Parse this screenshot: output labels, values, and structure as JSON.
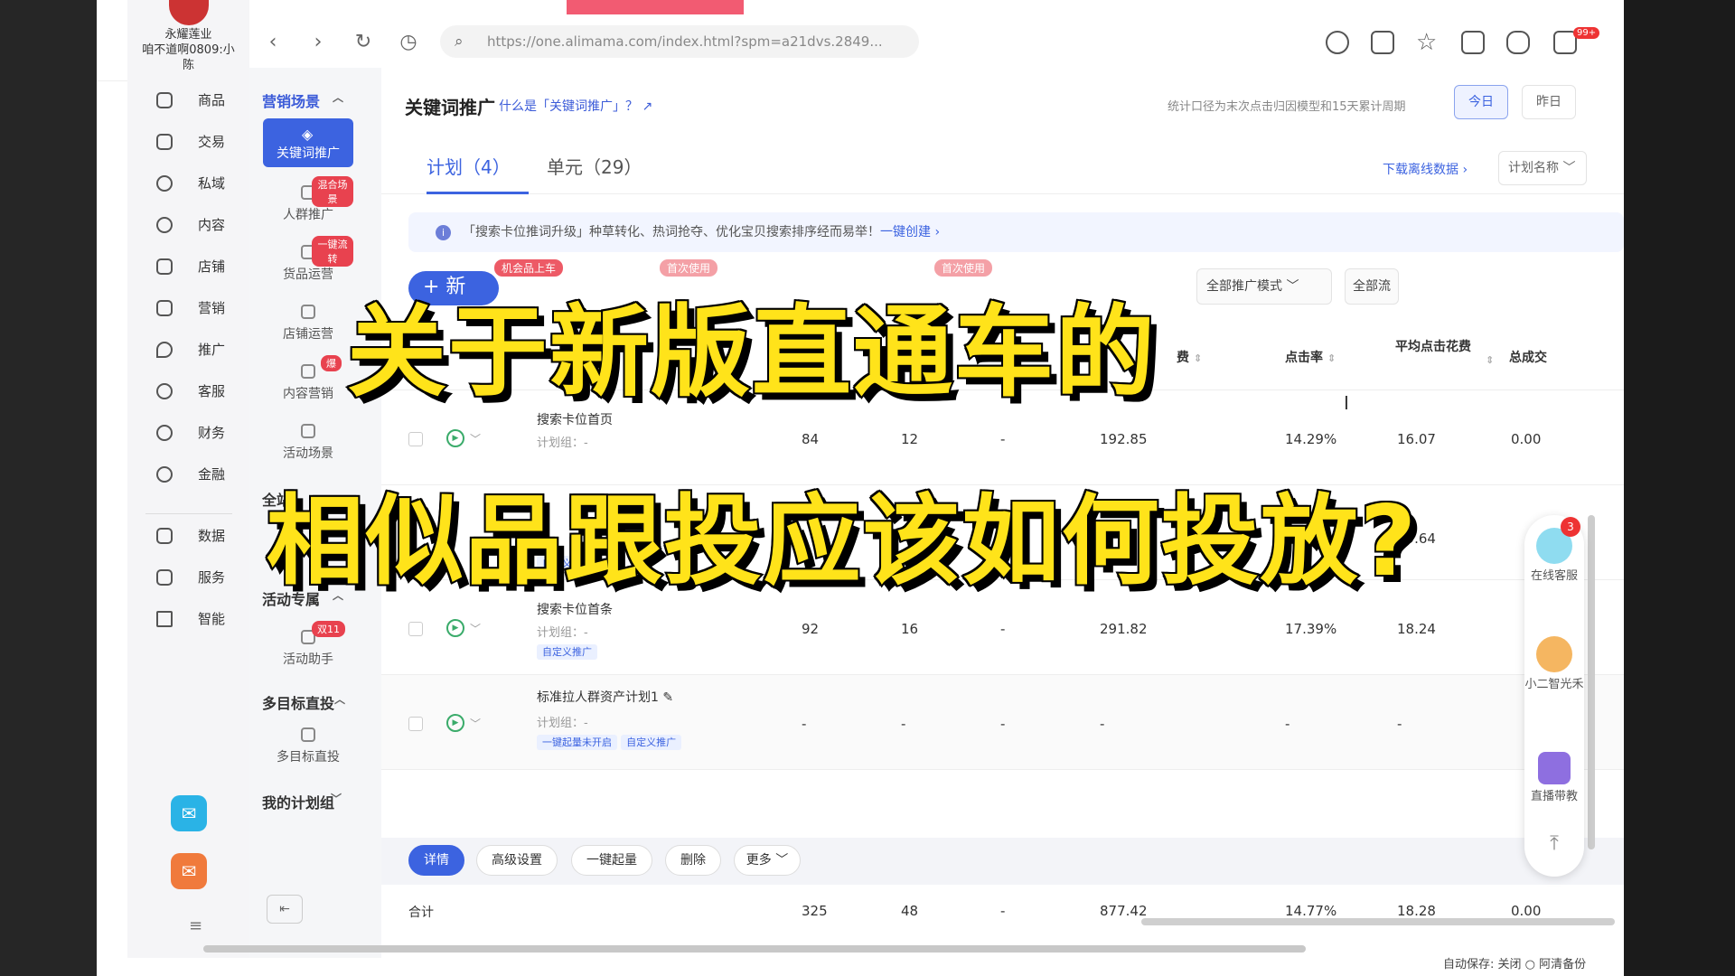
{
  "browser": {
    "url": "https://one.alimama.com/index.html?spm=a21dvs.2849...",
    "badge": "99+"
  },
  "brand": {
    "name": "永耀莲业",
    "user": "咱不道啊0809:小陈"
  },
  "main_nav": [
    "商品",
    "交易",
    "私域",
    "内容",
    "店铺",
    "营销",
    "推广",
    "客服",
    "财务",
    "金融",
    "数据",
    "服务",
    "智能"
  ],
  "subnav": {
    "section1": "营销场景",
    "active": "关键词推广",
    "items": [
      {
        "label": "人群推广",
        "tag": "混合场景"
      },
      {
        "label": "货品运营",
        "tag": "一键流转"
      },
      {
        "label": "店铺运营",
        "tag": ""
      },
      {
        "label": "内容营销",
        "tag": "爆"
      },
      {
        "label": "活动场景",
        "tag": ""
      }
    ],
    "section2": "全站",
    "section3": "活动专属",
    "items3": [
      {
        "label": "活动助手",
        "tag": "双11"
      }
    ],
    "section4": "多目标直投",
    "items4": [
      {
        "label": "多目标直投",
        "tag": ""
      }
    ],
    "section5": "我的计划组"
  },
  "header": {
    "title": "关键词推广",
    "whatis": "什么是「关键词推广」？",
    "note": "统计口径为末次点击归因模型和15天累计周期",
    "today": "今日",
    "yesterday": "昨日"
  },
  "tabs": {
    "plan": "计划（4）",
    "unit": "单元（29）",
    "download": "下载离线数据 ›",
    "sort": "计划名称"
  },
  "notice": {
    "text": "「搜索卡位推词升级」种草转化、热词抢夺、优化宝贝搜索排序经而易举！",
    "link": "一键创建 ›"
  },
  "toolbar": {
    "new": "+ 新",
    "tag1": "机会品上车",
    "tag2": "首次使用",
    "tag3": "首次使用",
    "mode": "全部推广模式",
    "mode2": "全部流"
  },
  "table": {
    "headers": [
      "费",
      "点击率",
      "平均点击花费",
      "总成交"
    ],
    "rows": [
      {
        "name": "搜索卡位首页",
        "group": "计划组：-",
        "tags": [],
        "v": [
          "84",
          "12",
          "-",
          "192.85",
          "14.29%",
          "16.07",
          "0.00"
        ]
      },
      {
        "name": "",
        "group": "",
        "tags": [
          "自定义推广"
        ],
        "v": [
          "",
          "",
          "",
          "",
          "",
          "19.64",
          ""
        ]
      },
      {
        "name": "搜索卡位首条",
        "group": "计划组：-",
        "tags": [
          "自定义推广"
        ],
        "v": [
          "92",
          "16",
          "-",
          "291.82",
          "17.39%",
          "18.24",
          ""
        ]
      },
      {
        "name": "标准拉人群资产计划1",
        "group": "计划组：-",
        "tags": [
          "一键起量未开启",
          "自定义推广"
        ],
        "v": [
          "-",
          "-",
          "-",
          "-",
          "-",
          "-",
          ""
        ]
      }
    ],
    "sum": {
      "label": "合计",
      "v": [
        "325",
        "48",
        "-",
        "877.42",
        "14.77%",
        "18.28",
        "0.00"
      ]
    }
  },
  "actions": [
    "详情",
    "高级设置",
    "一键起量",
    "删除",
    "更多"
  ],
  "float": {
    "badge": "3",
    "service": "在线客服",
    "assistant": "小二智光禾",
    "live": "直播带教",
    "top": "⤒"
  },
  "status": "自动保存: 关闭 ○ 阿清备份",
  "caption": {
    "line1": "关于新版直通车的",
    "line2": "相似品跟投应该如何投放?"
  }
}
